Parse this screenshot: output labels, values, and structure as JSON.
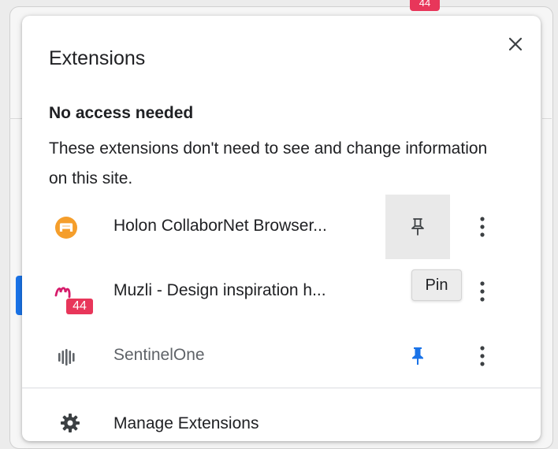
{
  "background": {
    "badge_count": "44"
  },
  "popup": {
    "title": "Extensions",
    "section_heading": "No access needed",
    "section_description": "These extensions don't need to see and change information on this site.",
    "extensions": [
      {
        "name": "Holon CollaborNet Browser...",
        "icon": "holon-logo-icon",
        "pinned": false,
        "pin_hovered": true
      },
      {
        "name": "Muzli - Design inspiration h...",
        "icon": "muzli-logo-icon",
        "badge": "44",
        "pinned": true
      },
      {
        "name": "SentinelOne",
        "icon": "sentinelone-logo-icon",
        "pinned": true
      }
    ],
    "tooltip": "Pin",
    "footer": {
      "manage_label": "Manage Extensions",
      "icon": "gear-icon"
    }
  },
  "colors": {
    "accent_blue": "#1a73e8",
    "badge_red": "#e8365a",
    "holon_orange": "#f59e2b",
    "muzli_pink": "#d61c6b",
    "text_primary": "#202124",
    "text_secondary": "#5f6368"
  }
}
